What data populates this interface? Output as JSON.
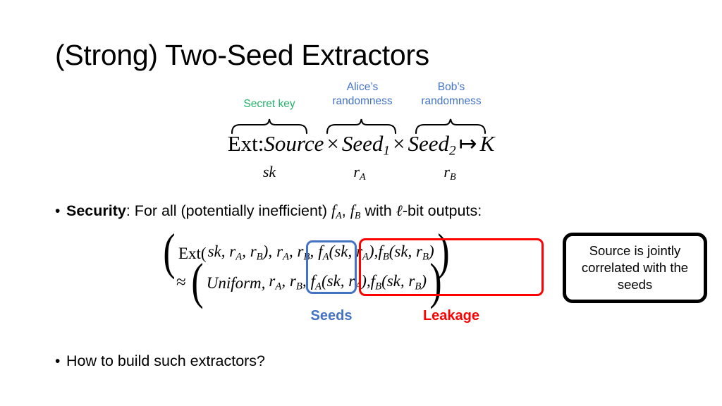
{
  "slide": {
    "title": "(Strong) Two-Seed Extractors"
  },
  "brace_labels": {
    "secret_key": "Secret key",
    "alice_randomness": "Alice’s\nrandomness",
    "alice_line1": "Alice’s",
    "alice_line2": "randomness",
    "bob_line1": "Bob’s",
    "bob_line2": "randomness"
  },
  "ext_formula": {
    "prefix": "Ext:",
    "source": "Source",
    "times1": "×",
    "seed1": "Seed",
    "seed1_sub": "1",
    "times2": "×",
    "seed2": "Seed",
    "seed2_sub": "2",
    "mapsto": "↦",
    "output": "K"
  },
  "under_labels": {
    "sk": "sk",
    "r": "r",
    "ra_sub": "A",
    "rb_sub": "B"
  },
  "bullets": {
    "bullet_char": "•",
    "security": {
      "strong": "Security",
      "rest_before_f": ": For all (potentially inefficient) ",
      "f": "f",
      "fa_sub": "A",
      "comma": ", ",
      "fb_sub": "B",
      "rest_after_f": " with ",
      "ell": "ℓ",
      "tail": "-bit outputs:"
    },
    "build": "How to build such extractors?"
  },
  "security_equation": {
    "row1": {
      "open_paren": "(",
      "ext": "Ext(",
      "args": "sk, r",
      "a_sub": "A",
      "comma1": ", r",
      "b_sub": "B",
      "close1": "),",
      "seeds": "r",
      "seeds_a": "A",
      "seeds_mid": ", r",
      "seeds_b": "B",
      "seeds_end": ",",
      "leak_fa": "f",
      "leak_fa_sub": "A",
      "leak_fa_args": "(sk, r",
      "leak_fa_argsub": "A",
      "leak_fa_close": "),",
      "leak_fb": "f",
      "leak_fb_sub": "B",
      "leak_fb_args": "(sk, r",
      "leak_fb_argsub": "B",
      "leak_fb_close": ")",
      "close_paren": ")"
    },
    "row2": {
      "approx": "≈",
      "open_paren": "(",
      "uniform": "Uniform,",
      "seeds": "r",
      "seeds_a": "A",
      "seeds_mid": ", r",
      "seeds_b": "B",
      "seeds_end": ",",
      "leak_fa": "f",
      "leak_fa_sub": "A",
      "leak_fa_args": "(sk, r",
      "leak_fa_argsub": "A",
      "leak_fa_close": "),",
      "leak_fb": "f",
      "leak_fb_sub": "B",
      "leak_fb_args": "(sk, r",
      "leak_fb_argsub": "B",
      "leak_fb_close": ")",
      "close_paren": ")"
    }
  },
  "captions": {
    "seeds": "Seeds",
    "leakage": "Leakage"
  },
  "callout": {
    "text": "Source is jointly correlated with the seeds"
  },
  "colors": {
    "green": "#23B26A",
    "blue": "#4472C4",
    "red": "#FF0000",
    "black": "#000000"
  }
}
